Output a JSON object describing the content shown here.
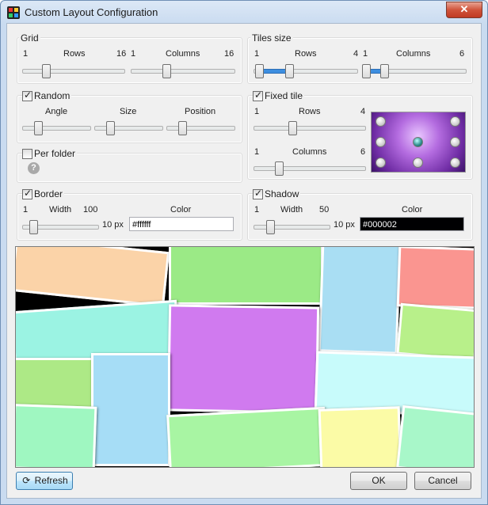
{
  "window": {
    "title": "Custom Layout Configuration",
    "close_label": "✕"
  },
  "grid": {
    "label": "Grid",
    "rows_label": "Rows",
    "cols_label": "Columns",
    "rows_min": "1",
    "rows_max": "16",
    "cols_min": "1",
    "cols_max": "16"
  },
  "tiles_size": {
    "label": "Tiles size",
    "rows_label": "Rows",
    "cols_label": "Columns",
    "rows_min": "1",
    "rows_max": "4",
    "cols_min": "1",
    "cols_max": "6"
  },
  "random": {
    "label": "Random",
    "checked": true,
    "angle_label": "Angle",
    "size_label": "Size",
    "position_label": "Position"
  },
  "fixed_tile": {
    "label": "Fixed tile",
    "checked": true,
    "rows_label": "Rows",
    "cols_label": "Columns",
    "rows_min": "1",
    "rows_max": "4",
    "cols_min": "1",
    "cols_max": "6"
  },
  "per_folder": {
    "label": "Per folder",
    "checked": false,
    "help": "?"
  },
  "border": {
    "label": "Border",
    "checked": true,
    "width_label": "Width",
    "min": "1",
    "max": "100",
    "value": "10 px",
    "color_label": "Color",
    "color": "#ffffff"
  },
  "shadow": {
    "label": "Shadow",
    "checked": true,
    "width_label": "Width",
    "min": "1",
    "max": "50",
    "value": "10 px",
    "color_label": "Color",
    "color": "#000002"
  },
  "buttons": {
    "refresh": "Refresh",
    "ok": "OK",
    "cancel": "Cancel"
  },
  "icons": {
    "app": "app-icon",
    "refresh": "refresh-icon",
    "help": "help-icon",
    "close": "close-icon"
  }
}
